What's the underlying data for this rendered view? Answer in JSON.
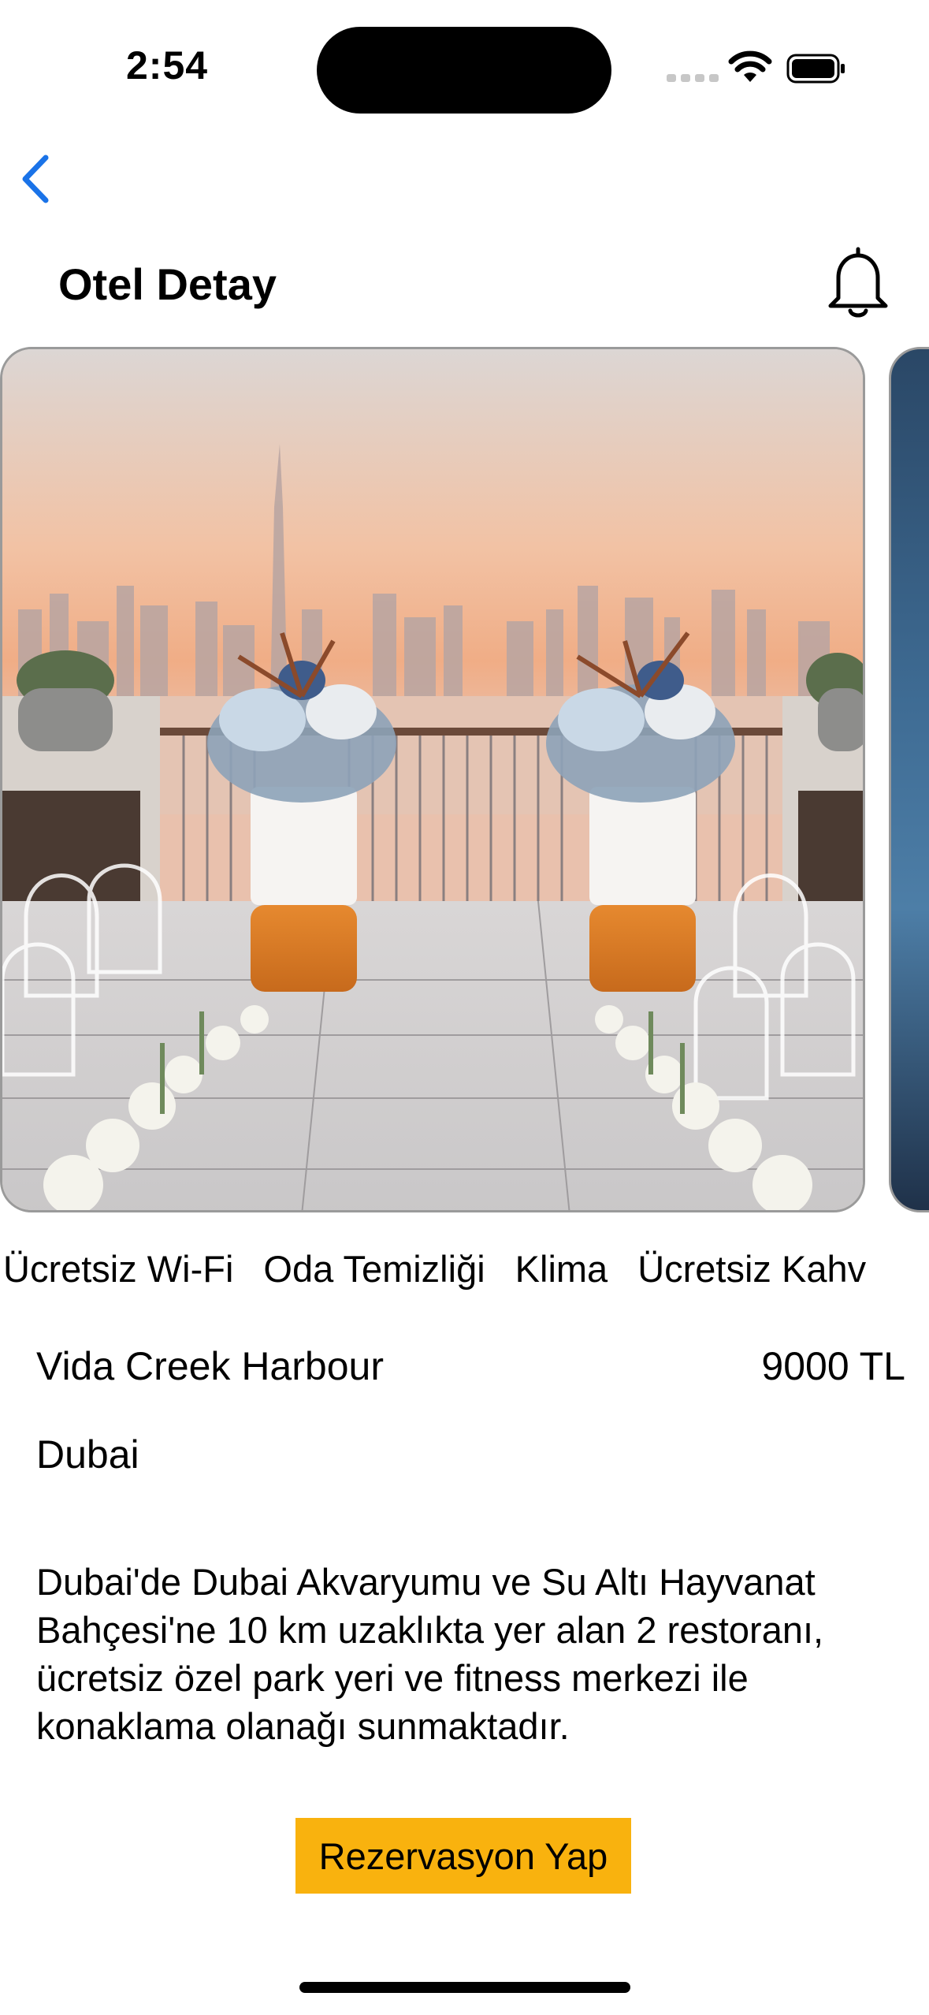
{
  "status_bar": {
    "time": "2:54"
  },
  "nav": {
    "title": "Otel Detay"
  },
  "amenities": [
    "Ücretsiz Wi-Fi",
    "Oda Temizliği",
    "Klima",
    "Ücretsiz Kahv"
  ],
  "hotel": {
    "name": "Vida Creek Harbour",
    "price": "9000 TL",
    "city": "Dubai",
    "description": "Dubai'de Dubai Akvaryumu ve Su Altı Hayvanat Bahçesi'ne 10 km uzaklıkta yer alan 2 restoranı, ücretsiz özel park yeri ve fitness merkezi ile konaklama olanağı sunmaktadır."
  },
  "actions": {
    "reserve_label": "Rezervasyon Yap"
  },
  "colors": {
    "accent": "#1a73e8",
    "button": "#f9b20e"
  }
}
